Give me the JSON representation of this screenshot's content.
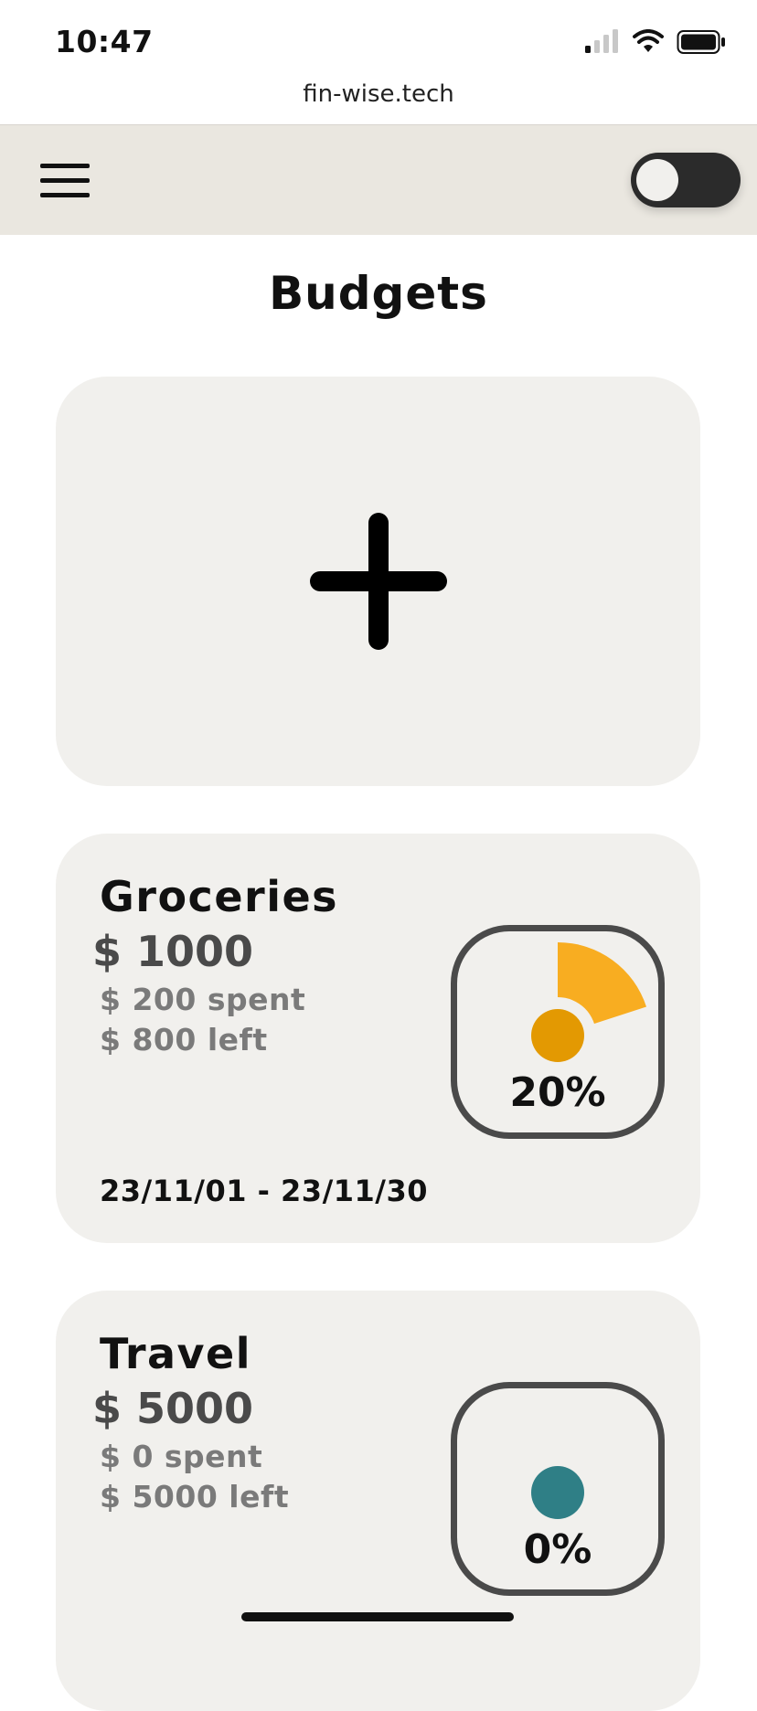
{
  "status_bar": {
    "time": "10:47"
  },
  "browser": {
    "url": "fin-wise.tech"
  },
  "header": {
    "menu_icon": "hamburger-icon",
    "theme_toggle_icon": "toggle-switch"
  },
  "page": {
    "title": "Budgets"
  },
  "add_budget": {
    "icon": "plus-icon"
  },
  "budgets": [
    {
      "name": "Groceries",
      "amount": "$ 1000",
      "spent": "$ 200 spent",
      "left": "$ 800 left",
      "percent": "20%",
      "percent_value": 20,
      "dates": "23/11/01 - 23/11/30",
      "color": "#f8ad21",
      "dot_color": "#e39902"
    },
    {
      "name": "Travel",
      "amount": "$ 5000",
      "spent": "$ 0 spent",
      "left": "$ 5000 left",
      "percent": "0%",
      "percent_value": 0,
      "dates": "",
      "color": "#2f7f86",
      "dot_color": "#2f7f86"
    }
  ],
  "colors": {
    "topbar_bg": "#eae7e0",
    "card_bg": "#f1f0ed",
    "gauge_border": "#4a4a4a",
    "text_dark": "#111111",
    "text_muted": "#7a7a7a"
  }
}
